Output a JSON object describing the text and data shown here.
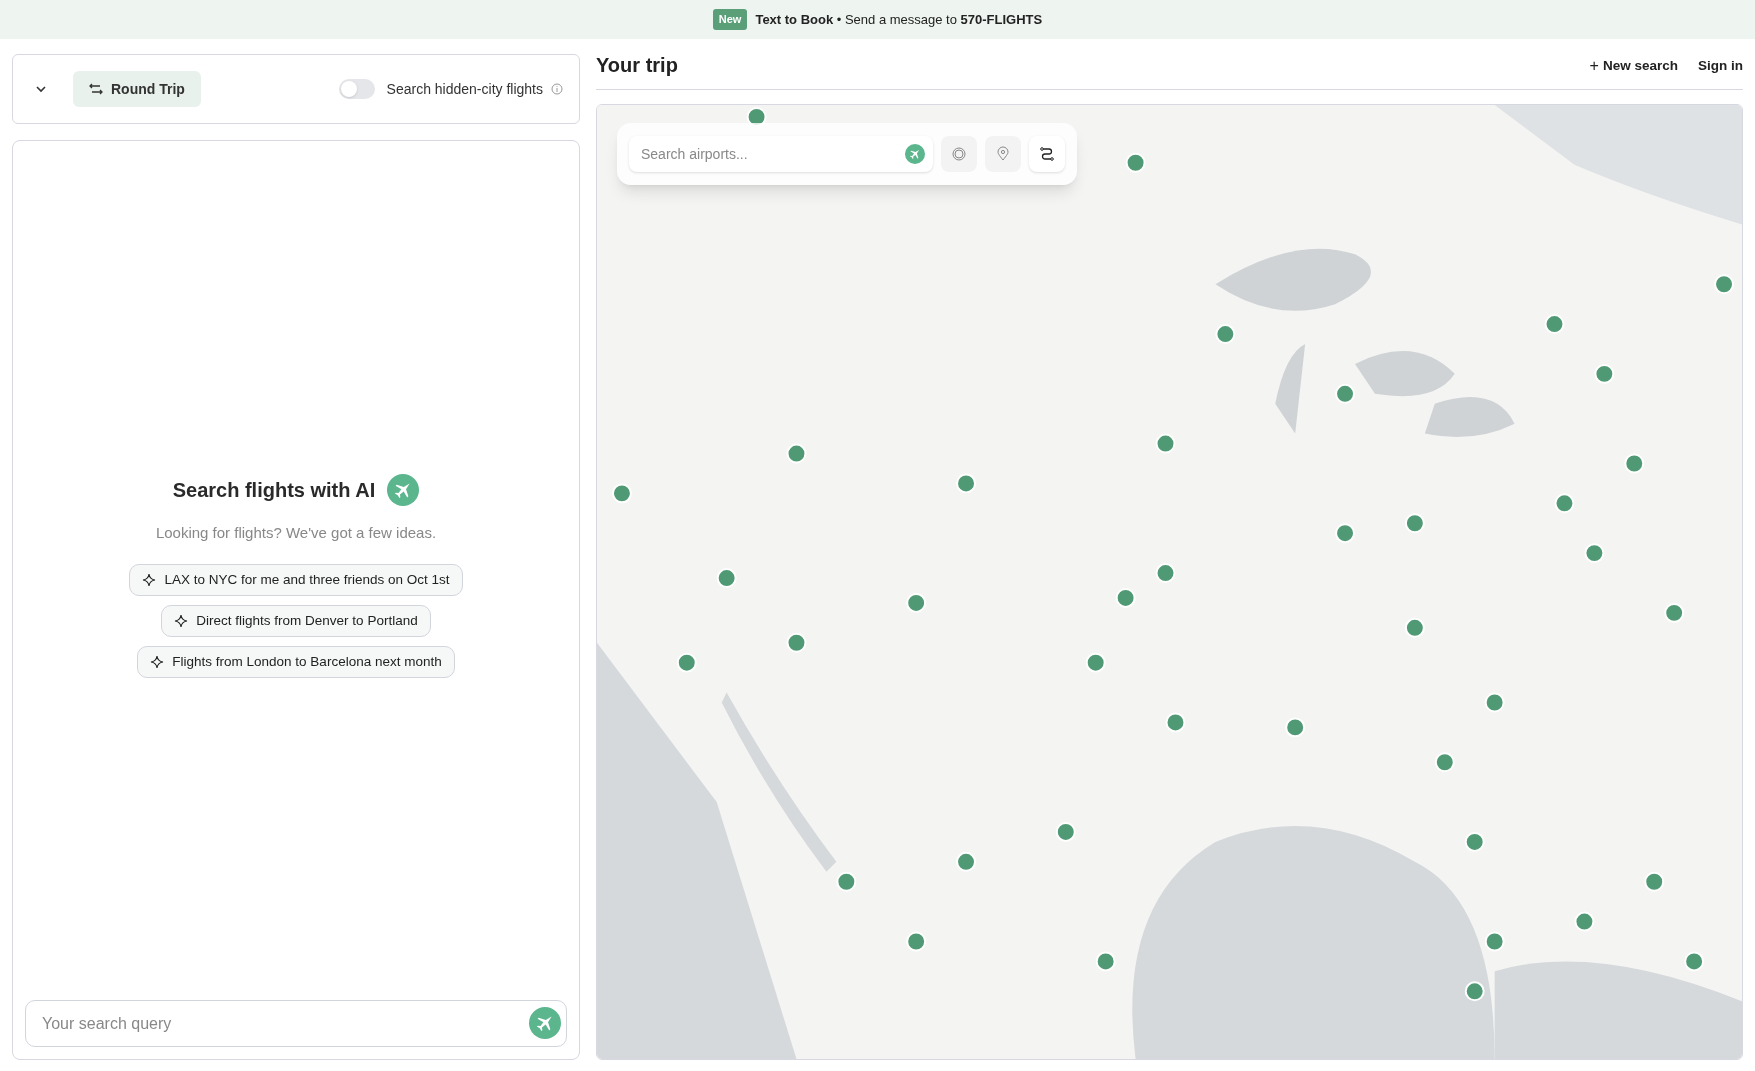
{
  "banner": {
    "badge": "New",
    "title": "Text to Book",
    "separator": "•",
    "message": "Send a message to",
    "number": "570-FLIGHTS"
  },
  "trip_bar": {
    "mode": "Round Trip",
    "hidden_city": {
      "label": "Search hidden-city flights",
      "on": false
    }
  },
  "assistant": {
    "title": "Search flights with AI",
    "subtitle": "Looking for flights? We've got a few ideas.",
    "suggestions": [
      "LAX to NYC for me and three friends on Oct 1st",
      "Direct flights from Denver to Portland",
      "Flights from London to Barcelona next month"
    ],
    "input": {
      "placeholder": "Your search query"
    }
  },
  "header": {
    "title": "Your trip",
    "actions": [
      {
        "icon": "+",
        "label": "New search"
      },
      {
        "label": "Sign in"
      }
    ]
  },
  "map": {
    "search": {
      "placeholder": "Search airports..."
    },
    "tools": [
      {
        "kind": "radius",
        "selected": false
      },
      {
        "kind": "pin",
        "selected": false
      },
      {
        "kind": "route",
        "selected": true
      }
    ]
  }
}
